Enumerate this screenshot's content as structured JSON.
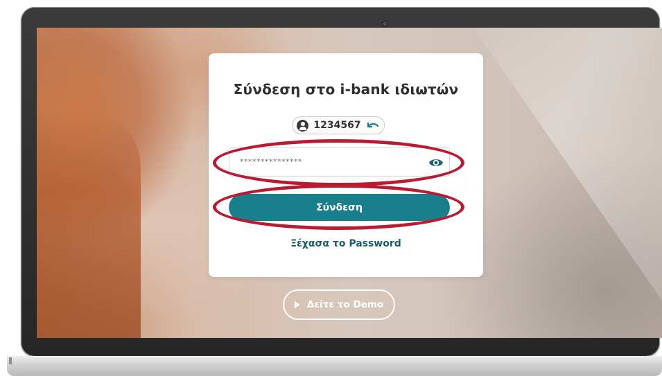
{
  "login": {
    "title": "Σύνδεση στο i-bank ιδιωτών",
    "user_id": "1234567",
    "password_value": "***************",
    "submit_label": "Σύνδεση",
    "forgot_label": "Ξέχασα το Password"
  },
  "demo": {
    "label": "Δείτε το Demo"
  },
  "icons": {
    "user": "user-circle-icon",
    "change_user": "undo-arrow-icon",
    "show_password": "eye-icon",
    "play": "play-icon"
  },
  "colors": {
    "primary": "#1a7f8c",
    "link": "#1a5d68",
    "highlight": "#b81c32"
  }
}
